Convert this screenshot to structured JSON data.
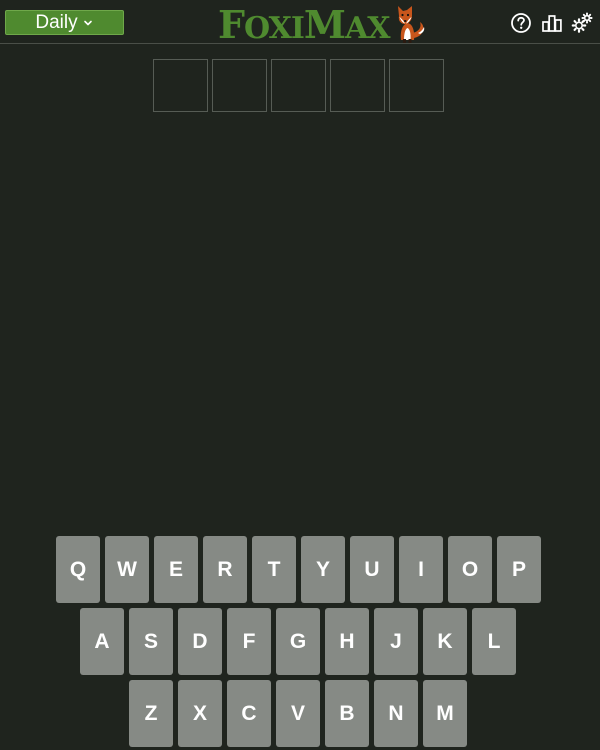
{
  "header": {
    "mode_label": "Daily",
    "logo_text": {
      "part1": "F",
      "part2": "OXI",
      "part3": "M",
      "part4": "AX"
    }
  },
  "board": {
    "row_length": 5,
    "tiles": [
      "",
      "",
      "",
      "",
      ""
    ]
  },
  "keyboard": {
    "rows": [
      [
        "Q",
        "W",
        "E",
        "R",
        "T",
        "Y",
        "U",
        "I",
        "O",
        "P"
      ],
      [
        "A",
        "S",
        "D",
        "F",
        "G",
        "H",
        "J",
        "K",
        "L"
      ],
      [
        "Z",
        "X",
        "C",
        "V",
        "B",
        "N",
        "M"
      ]
    ]
  },
  "colors": {
    "background": "#1f241e",
    "accent": "#4f8a2f",
    "key": "#868a85",
    "tile_border": "#565c55"
  }
}
